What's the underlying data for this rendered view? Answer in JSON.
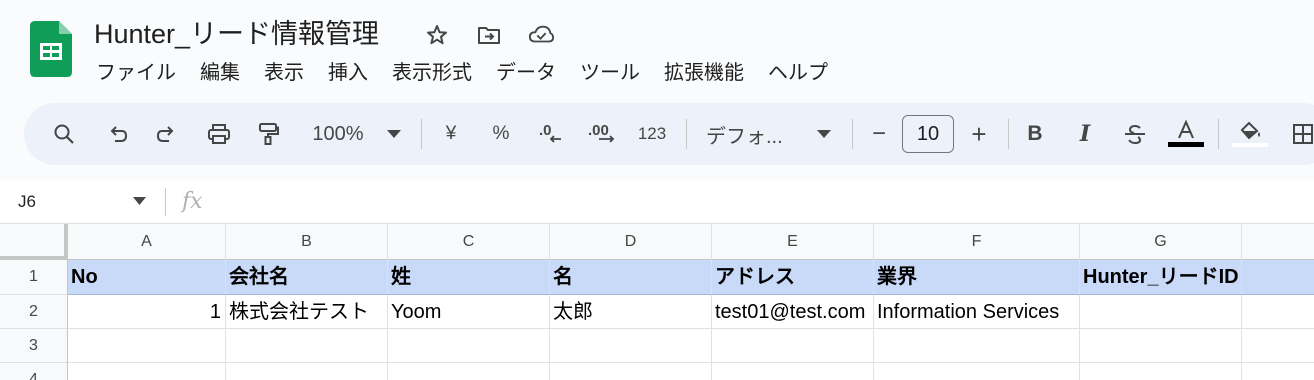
{
  "app": {
    "title": "Hunter_リード情報管理",
    "colors": {
      "sheets_green": "#0f9d58",
      "header_fill": "#c9daf8",
      "toolbar_bg": "#edf2fa"
    }
  },
  "title_icons": [
    "star-icon",
    "move-to-folder-icon",
    "cloud-status-icon"
  ],
  "menu": [
    "ファイル",
    "編集",
    "表示",
    "挿入",
    "表示形式",
    "データ",
    "ツール",
    "拡張機能",
    "ヘルプ"
  ],
  "toolbar": {
    "zoom": "100%",
    "currency": "¥",
    "percent": "%",
    "more_formats": "123",
    "font": "デフォ...",
    "font_size": "10",
    "minus": "−",
    "plus": "+"
  },
  "formula_bar": {
    "cell_ref": "J6",
    "fx": "fx",
    "value": ""
  },
  "sheet": {
    "columns": [
      "A",
      "B",
      "C",
      "D",
      "E",
      "F",
      "G"
    ],
    "rows": [
      "1",
      "2",
      "3",
      "4"
    ],
    "header_row": [
      "No",
      "会社名",
      "姓",
      "名",
      "アドレス",
      "業界",
      "Hunter_リードID"
    ],
    "data_rows": [
      [
        "1",
        "株式会社テスト",
        "Yoom",
        "太郎",
        "test01@test.com",
        "Information Services",
        ""
      ]
    ]
  }
}
